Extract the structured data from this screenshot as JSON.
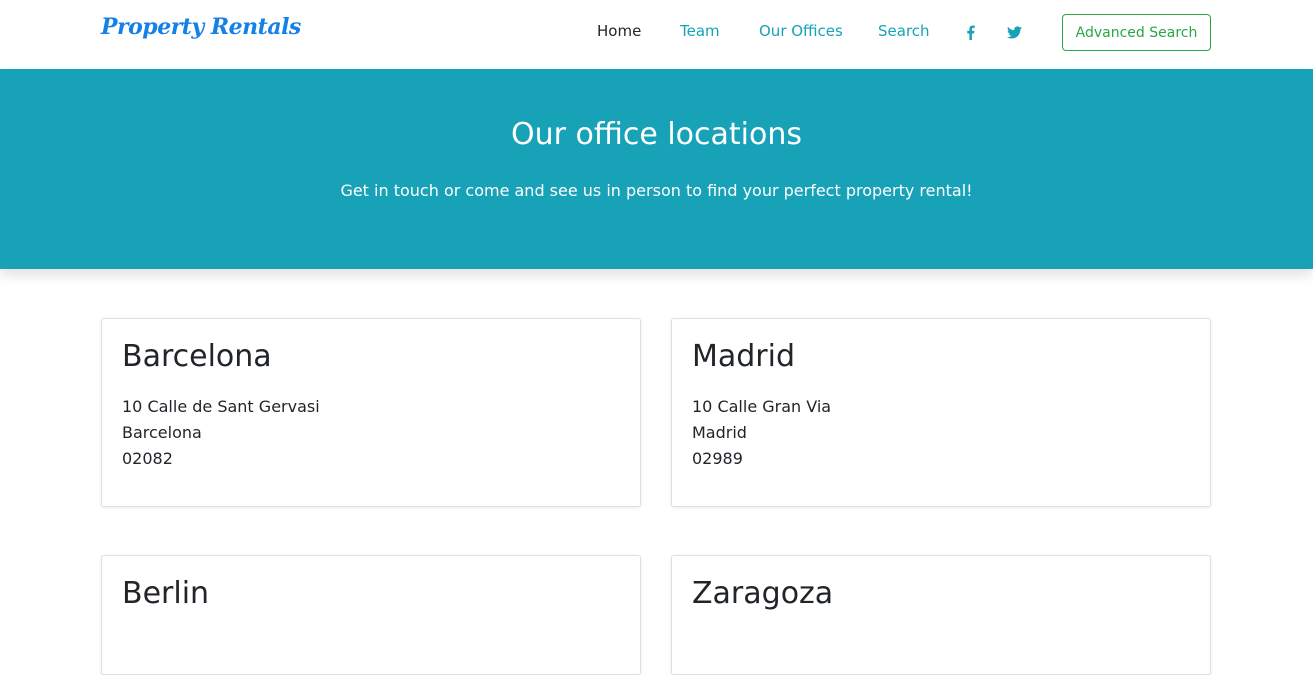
{
  "navbar": {
    "brand": "Property Rentals",
    "links": [
      {
        "label": "Home",
        "active": true
      },
      {
        "label": "Team",
        "active": false
      },
      {
        "label": "Our Offices",
        "active": false
      },
      {
        "label": "Search",
        "active": false
      }
    ],
    "social": [
      "facebook-icon",
      "twitter-icon"
    ],
    "cta_label": "Advanced Search"
  },
  "hero": {
    "title": "Our office locations",
    "subtitle": "Get in touch or come and see us in person to find your perfect property rental!"
  },
  "offices": [
    {
      "city": "Barcelona",
      "lines": [
        "10 Calle de Sant Gervasi",
        "Barcelona",
        "02082"
      ]
    },
    {
      "city": "Madrid",
      "lines": [
        "10 Calle Gran Via",
        "Madrid",
        "02989"
      ]
    },
    {
      "city": "Berlin",
      "lines": []
    },
    {
      "city": "Zaragoza",
      "lines": []
    }
  ],
  "colors": {
    "brand": "#1580e8",
    "accent": "#17a2b8",
    "success": "#28a745",
    "text": "#212529"
  }
}
